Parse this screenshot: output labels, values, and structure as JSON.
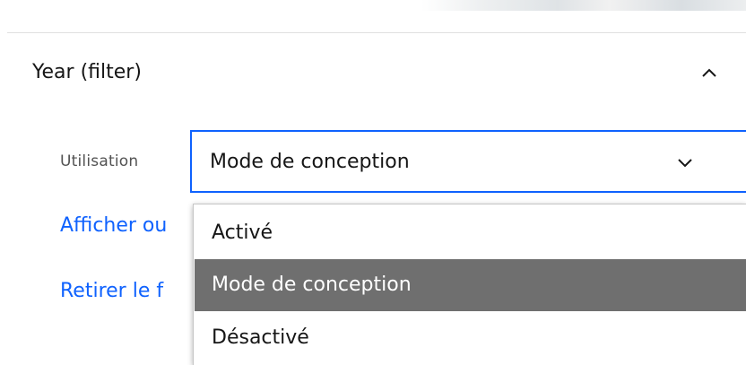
{
  "panel": {
    "title": "Year (filter)",
    "collapse_icon": "chevron-up-icon"
  },
  "usage": {
    "label": "Utilisation",
    "selected": "Mode de conception",
    "chevron_icon": "chevron-down-icon",
    "options": [
      {
        "label": "Activé",
        "highlighted": false
      },
      {
        "label": "Mode de conception",
        "highlighted": true
      },
      {
        "label": "Désactivé",
        "highlighted": false
      }
    ]
  },
  "links": {
    "show_visible_text": "Afficher ou",
    "remove_visible_text": "Retirer le f"
  },
  "colors": {
    "accent": "#0f62fe",
    "highlight_bg": "#6f6f6f",
    "text": "#161616",
    "label": "#525252",
    "divider": "#e0e0e0"
  }
}
